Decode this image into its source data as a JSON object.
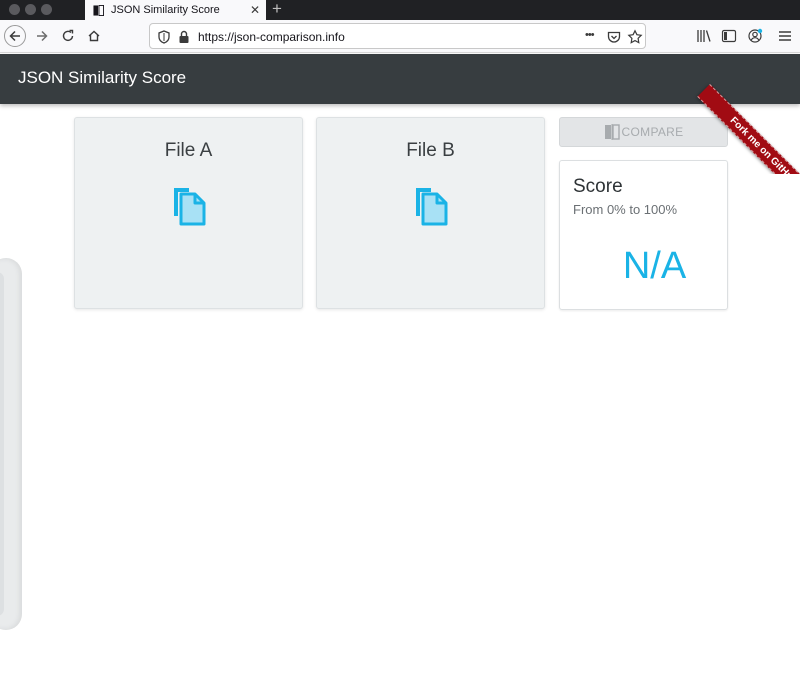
{
  "browser": {
    "tab_title": "JSON Similarity Score",
    "tab_close": "✕",
    "new_tab": "+",
    "url": "https://json-comparison.info",
    "more_dots": "•••"
  },
  "app": {
    "title": "JSON Similarity Score",
    "ribbon_text": "Fork me on GitHub"
  },
  "cards": {
    "file_a": {
      "title": "File A"
    },
    "file_b": {
      "title": "File B"
    }
  },
  "compare": {
    "label": "COMPARE"
  },
  "score": {
    "title": "Score",
    "subtitle": "From 0% to 100%",
    "value": "N/A"
  },
  "colors": {
    "header_bg": "#373d40",
    "accent": "#1ab3e6",
    "ribbon": "#a10b13",
    "card_bg": "#eef1f2"
  },
  "icons": {
    "file": "copy-files-icon",
    "compare": "compare-icon",
    "lock": "lock-icon",
    "shield": "shield-icon"
  }
}
